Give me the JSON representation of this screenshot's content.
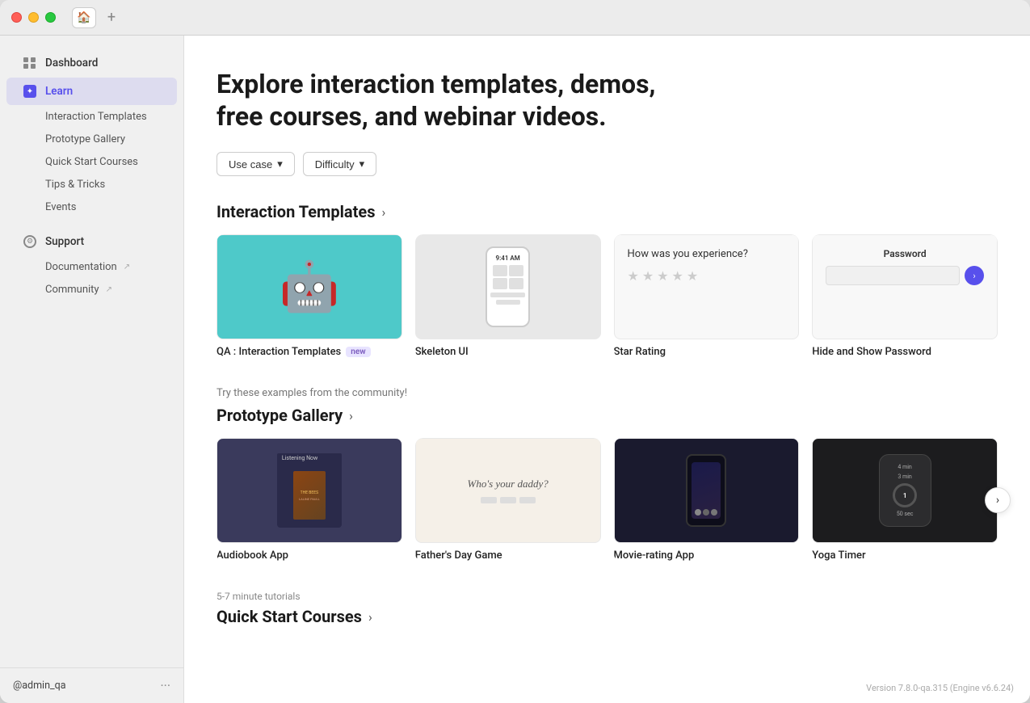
{
  "window": {
    "title": "Learn"
  },
  "titlebar": {
    "home_tab": "🏠",
    "new_tab": "+"
  },
  "sidebar": {
    "items": [
      {
        "id": "dashboard",
        "label": "Dashboard",
        "icon": "dashboard-icon",
        "active": false
      },
      {
        "id": "learn",
        "label": "Learn",
        "icon": "learn-icon",
        "active": true
      }
    ],
    "learn_subitems": [
      {
        "id": "interaction-templates",
        "label": "Interaction Templates"
      },
      {
        "id": "prototype-gallery",
        "label": "Prototype Gallery"
      },
      {
        "id": "quick-start-courses",
        "label": "Quick Start Courses"
      },
      {
        "id": "tips-tricks",
        "label": "Tips & Tricks"
      },
      {
        "id": "events",
        "label": "Events"
      }
    ],
    "support": {
      "label": "Support",
      "subitems": [
        {
          "id": "documentation",
          "label": "Documentation",
          "external": true
        },
        {
          "id": "community",
          "label": "Community",
          "external": true
        }
      ]
    },
    "user": "@admin_qa",
    "more": "···"
  },
  "main": {
    "page_title": "Explore interaction templates, demos, free courses, and webinar videos.",
    "filters": [
      {
        "label": "Use case",
        "icon": "chevron-down"
      },
      {
        "label": "Difficulty",
        "icon": "chevron-down"
      }
    ],
    "sections": {
      "interaction_templates": {
        "title": "Interaction Templates",
        "cards": [
          {
            "id": "qa-templates",
            "label": "QA : Interaction Templates",
            "badge": "new",
            "thumb_type": "monster"
          },
          {
            "id": "skeleton-ui",
            "label": "Skeleton UI",
            "badge": "",
            "thumb_type": "phone-skeleton"
          },
          {
            "id": "star-rating",
            "label": "Star Rating",
            "badge": "",
            "thumb_type": "star-rating"
          },
          {
            "id": "hide-show-password",
            "label": "Hide and Show Password",
            "badge": "",
            "thumb_type": "password"
          }
        ]
      },
      "prototype_gallery": {
        "title": "Prototype Gallery",
        "community_tip": "Try these examples from the community!",
        "cards": [
          {
            "id": "audiobook-app",
            "label": "Audiobook App",
            "thumb_type": "audiobook"
          },
          {
            "id": "fathers-day-game",
            "label": "Father's Day Game",
            "thumb_type": "daddy"
          },
          {
            "id": "movie-rating-app",
            "label": "Movie-rating App",
            "thumb_type": "movie"
          },
          {
            "id": "yoga-timer",
            "label": "Yoga Timer",
            "thumb_type": "yoga"
          }
        ]
      },
      "quick_start_courses": {
        "meta": "5-7 minute tutorials",
        "title": "Quick Start Courses"
      }
    },
    "version": "Version 7.8.0-qa.315 (Engine v6.6.24)"
  }
}
